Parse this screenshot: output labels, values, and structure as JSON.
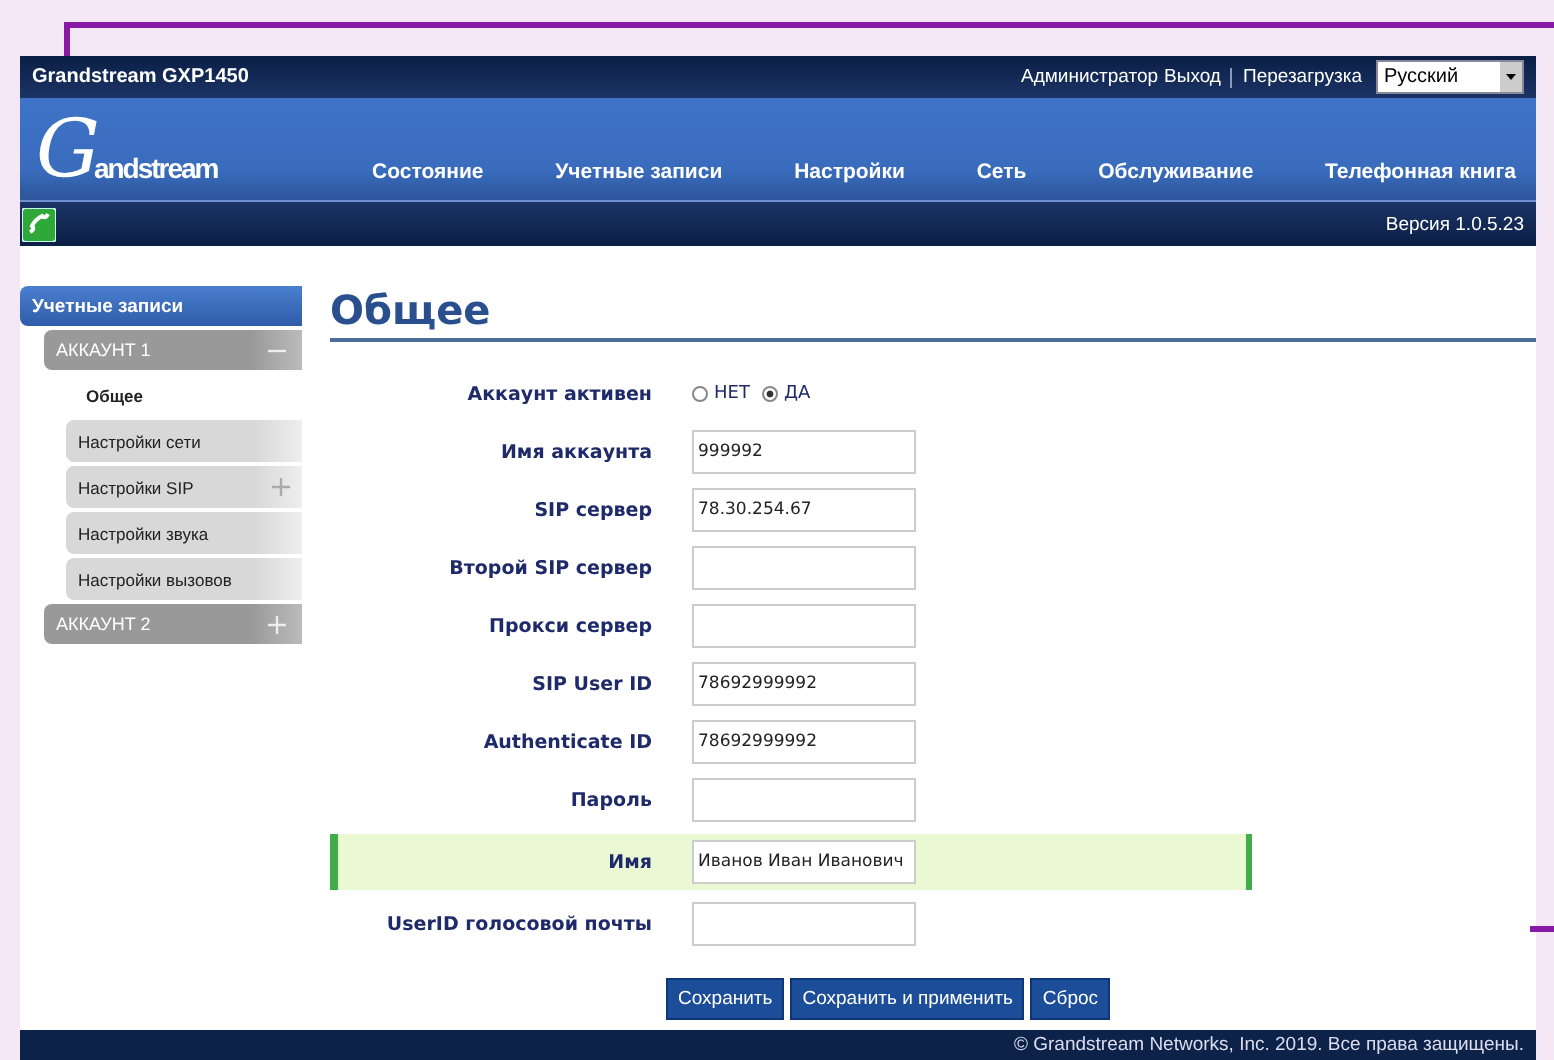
{
  "window": {
    "title": "Grandstream GXP1450"
  },
  "top_links": [
    {
      "label": "Администратор"
    },
    {
      "label": "Выход"
    },
    {
      "label": "Перезагрузка"
    }
  ],
  "language": {
    "value": "Русский"
  },
  "logo": {
    "initial": "G",
    "rest": "andstream"
  },
  "nav": [
    {
      "label": "Состояние"
    },
    {
      "label": "Учетные записи"
    },
    {
      "label": "Настройки"
    },
    {
      "label": "Сеть"
    },
    {
      "label": "Обслуживание"
    },
    {
      "label": "Телефонная книга"
    }
  ],
  "version": "Версия 1.0.5.23",
  "sidebar": {
    "title": "Учетные записи",
    "items": [
      {
        "label": "АККАУНТ 1",
        "expanded": true,
        "children": [
          {
            "label": "Общее",
            "selected": true,
            "expandable": false
          },
          {
            "label": "Настройки сети",
            "selected": false,
            "expandable": false
          },
          {
            "label": "Настройки SIP",
            "selected": false,
            "expandable": true
          },
          {
            "label": "Настройки звука",
            "selected": false,
            "expandable": false
          },
          {
            "label": "Настройки вызовов",
            "selected": false,
            "expandable": false
          }
        ]
      },
      {
        "label": "АККАУНТ 2",
        "expanded": false
      }
    ]
  },
  "page_title": "Общее",
  "form": [
    {
      "kind": "radio",
      "label": "Аккаунт активен",
      "options": [
        {
          "label": "НЕТ",
          "selected": false
        },
        {
          "label": "ДА",
          "selected": true
        }
      ]
    },
    {
      "kind": "text",
      "label": "Имя аккаунта",
      "value": "999992"
    },
    {
      "kind": "text",
      "label": "SIP сервер",
      "value": "78.30.254.67"
    },
    {
      "kind": "text",
      "label": "Второй SIP сервер"
    },
    {
      "kind": "text",
      "label": "Прокси сервер"
    },
    {
      "kind": "text",
      "label": "SIP User ID",
      "value": "78692999992"
    },
    {
      "kind": "text",
      "label": "Authenticate ID",
      "value": "78692999992"
    },
    {
      "kind": "text",
      "label": "Пароль"
    },
    {
      "kind": "text",
      "label": "Имя",
      "value": "Иванов Иван Иванович",
      "highlighted": true
    },
    {
      "kind": "text",
      "label": "UserID голосовой почты"
    }
  ],
  "buttons": [
    "Сохранить",
    "Сохранить и применить",
    "Сброс"
  ],
  "footer": "© Grandstream Networks, Inc. 2019. Все права защищены."
}
